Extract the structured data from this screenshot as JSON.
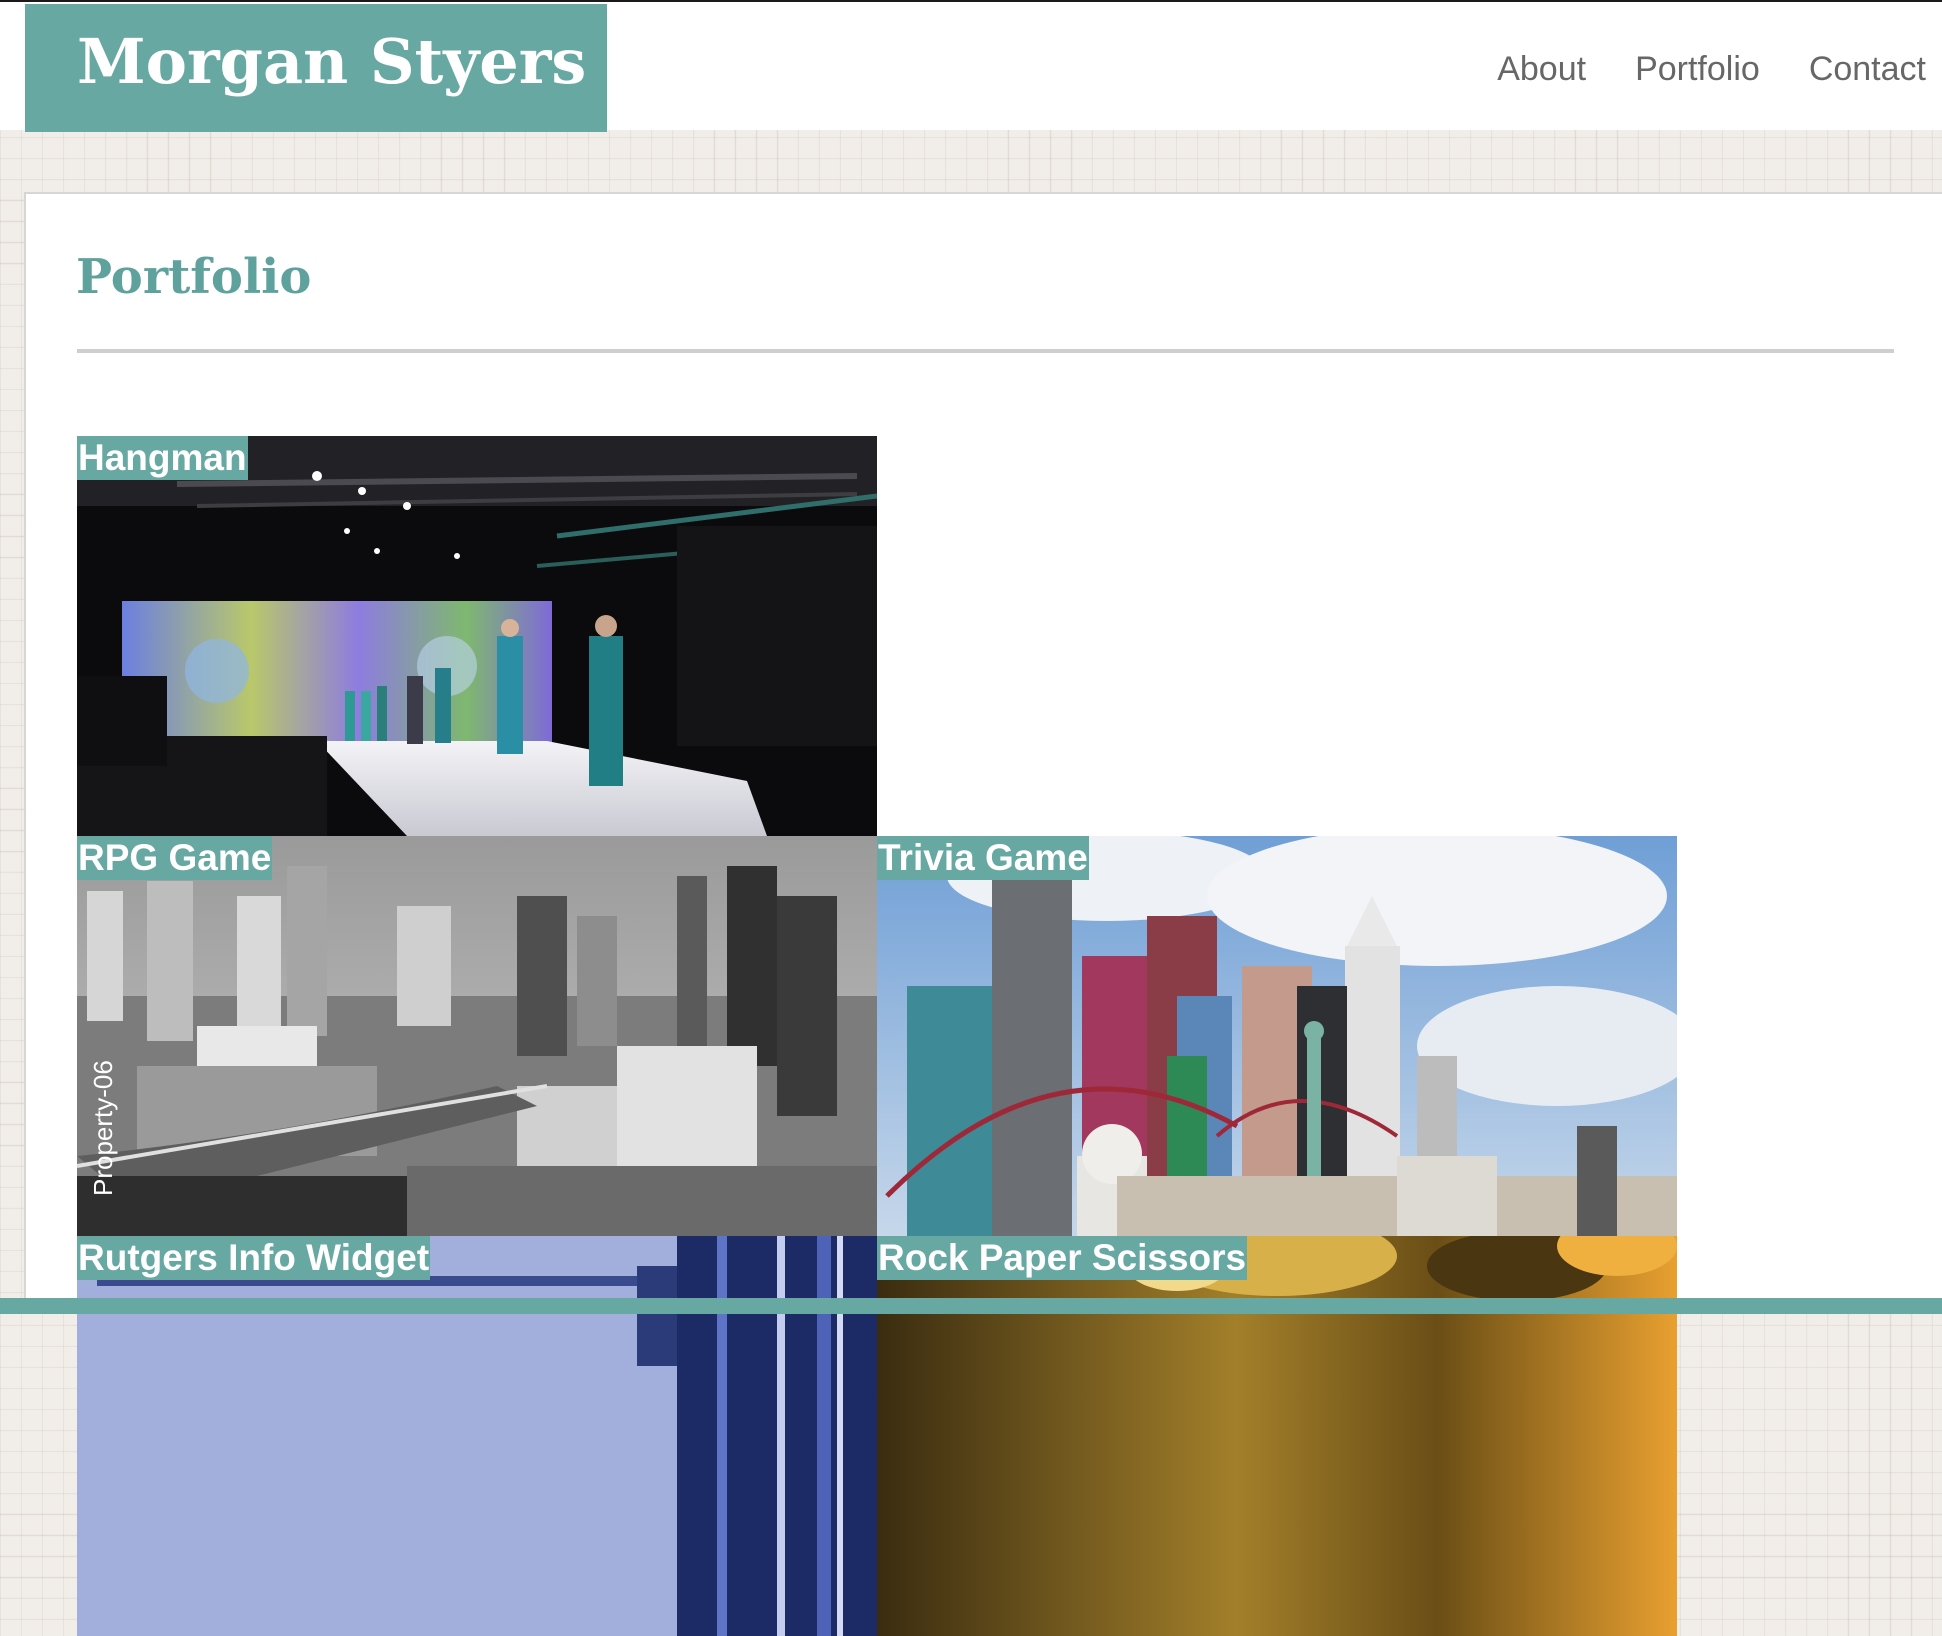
{
  "header": {
    "site_title": "Morgan Styers",
    "nav": [
      "About",
      "Portfolio",
      "Contact"
    ]
  },
  "main": {
    "page_title": "Portfolio",
    "projects": [
      {
        "label": "Hangman",
        "image": "fashion-runway-photo"
      },
      {
        "label": "RPG Game",
        "image": "black-and-white-city-photo",
        "watermark": "Property-06"
      },
      {
        "label": "Trivia Game",
        "image": "las-vegas-skyline-photo"
      },
      {
        "label": "Rutgers Info Widget",
        "image": "blue-machinery-photo"
      },
      {
        "label": "Rock Paper Scissors",
        "image": "gold-hands-photo"
      }
    ]
  },
  "colors": {
    "accent": "#67a8a3",
    "title_teal": "#5fa29d",
    "nav_text": "#676767",
    "page_background": "#f1eee9"
  }
}
